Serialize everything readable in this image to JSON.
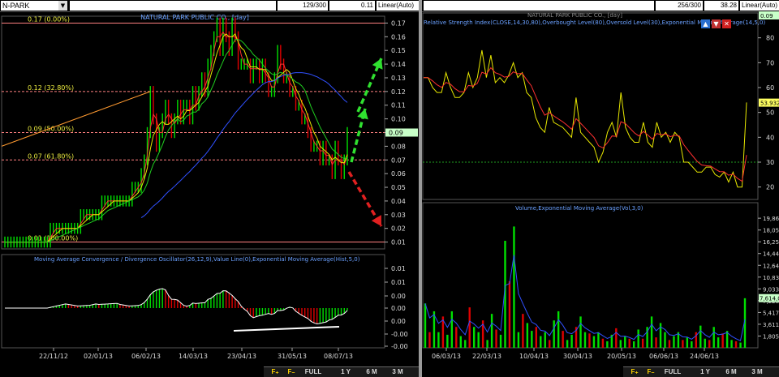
{
  "toolbar_left": {
    "symbol": "N-PARK",
    "bars": "129/300",
    "last": "0.11",
    "scale": "Linear(Auto)"
  },
  "toolbar_right": {
    "bars": "256/300",
    "last": "38.28",
    "scale": "Linear(Auto)",
    "value_box": "0.09"
  },
  "timeframe_buttons": [
    "FULL",
    "1 Y",
    "6 M",
    "3 M"
  ],
  "icons": [
    "zoom-in-icon",
    "zoom-out-icon",
    "dropdown-arrow-icon",
    "arrow-up-icon",
    "arrow-down-icon",
    "close-icon"
  ],
  "colors": {
    "up": "#00e000",
    "down": "#e00000",
    "ma_red": "#ff3030",
    "ma_yellow": "#e8e800",
    "ma_green": "#20d020",
    "ma_blue": "#3050ff",
    "fib": "#ff8080",
    "trend_up": "#30e030",
    "trend_down": "#e02020"
  },
  "chart_data": [
    {
      "type": "bar",
      "title": "NATURAL PARK PUBLIC CO., [day]",
      "y_ticks": [
        "0.17",
        "0.16",
        "0.15",
        "0.14",
        "0.13",
        "0.12",
        "0.11",
        "0.10",
        "0.09",
        "0.08",
        "0.07",
        "0.06",
        "0.05",
        "0.04",
        "0.03",
        "0.02",
        "0.01"
      ],
      "ylim": [
        0.005,
        0.175
      ],
      "x_tick_labels": [
        "22/11/12",
        "02/01/13",
        "06/02/13",
        "14/03/13",
        "23/04/13",
        "31/05/13",
        "08/07/13"
      ],
      "last_price_label": "0.09",
      "fib_levels": [
        {
          "label": "0.17 (0.00%)",
          "value": 0.17
        },
        {
          "label": "0.12 (32.80%)",
          "value": 0.12
        },
        {
          "label": "0.09 (50.00%)",
          "value": 0.09
        },
        {
          "label": "0.07 (61.80%)",
          "value": 0.07
        },
        {
          "label": "0.01 (100.00%)",
          "value": 0.01
        }
      ],
      "closes": [
        0.01,
        0.01,
        0.01,
        0.01,
        0.01,
        0.01,
        0.01,
        0.01,
        0.01,
        0.01,
        0.01,
        0.01,
        0.01,
        0.01,
        0.01,
        0.02,
        0.02,
        0.02,
        0.02,
        0.02,
        0.02,
        0.02,
        0.02,
        0.02,
        0.02,
        0.03,
        0.03,
        0.03,
        0.03,
        0.03,
        0.03,
        0.03,
        0.04,
        0.04,
        0.04,
        0.04,
        0.04,
        0.04,
        0.04,
        0.04,
        0.04,
        0.04,
        0.05,
        0.05,
        0.05,
        0.06,
        0.07,
        0.09,
        0.12,
        0.1,
        0.08,
        0.09,
        0.1,
        0.11,
        0.1,
        0.09,
        0.1,
        0.11,
        0.1,
        0.11,
        0.11,
        0.1,
        0.12,
        0.11,
        0.12,
        0.13,
        0.12,
        0.14,
        0.15,
        0.16,
        0.17,
        0.15,
        0.17,
        0.16,
        0.15,
        0.17,
        0.16,
        0.14,
        0.14,
        0.14,
        0.14,
        0.13,
        0.14,
        0.14,
        0.13,
        0.14,
        0.13,
        0.12,
        0.12,
        0.13,
        0.15,
        0.14,
        0.13,
        0.13,
        0.12,
        0.12,
        0.11,
        0.11,
        0.1,
        0.1,
        0.09,
        0.08,
        0.08,
        0.08,
        0.07,
        0.08,
        0.07,
        0.07,
        0.06,
        0.08,
        0.07,
        0.06,
        0.07,
        0.09
      ],
      "moving_averages": [
        "red",
        "yellow",
        "green",
        "blue"
      ],
      "trend_arrows": [
        "up",
        "up",
        "down"
      ]
    },
    {
      "type": "bar",
      "title": "Moving Average Convergence / Divergence Oscillator(26,12,9),Value Line(0),Exponential Moving Average(Hist,5,0)",
      "y_ticks": [
        "0.01",
        "0.01",
        "0.00",
        "0.00",
        "0.00",
        "-0.00",
        "-0.00"
      ],
      "ylim": [
        -0.0045,
        0.0045
      ]
    },
    {
      "type": "line",
      "title": "Relative Strength Index(CLOSE,14,30,80),Overbought Level(80),Oversold Level(30),Exponential Moving Average(14,5,0)",
      "header_title": "NATURAL PARK PUBLIC CO., [day]",
      "y_ticks": [
        "80",
        "70",
        "60",
        "50",
        "40",
        "30",
        "20"
      ],
      "ylim": [
        15,
        90
      ],
      "last_value_label": "53.9324",
      "overbought": 80,
      "oversold": 30,
      "values": [
        64,
        64,
        60,
        58,
        58,
        66,
        60,
        56,
        56,
        58,
        66,
        60,
        64,
        75,
        64,
        73,
        62,
        64,
        62,
        65,
        70,
        64,
        66,
        58,
        56,
        48,
        44,
        42,
        52,
        46,
        45,
        44,
        42,
        40,
        56,
        42,
        40,
        38,
        36,
        30,
        34,
        42,
        46,
        40,
        58,
        44,
        40,
        38,
        38,
        46,
        38,
        36,
        46,
        40,
        42,
        38,
        42,
        40,
        30,
        30,
        28,
        26,
        26,
        28,
        28,
        25,
        24,
        26,
        22,
        26,
        20,
        20,
        54
      ]
    },
    {
      "type": "bar",
      "title": "Volume,Exponential Moving Average(Vol,3,0)",
      "y_ticks": [
        "19,865",
        "18,052",
        "16,250",
        "14,448",
        "12,643",
        "10,838",
        "9,033",
        "7,228",
        "5,417",
        "3,611",
        "1,805"
      ],
      "last_value_label": "7,614,0",
      "ylim": [
        0,
        21000
      ],
      "x_tick_labels": [
        "06/03/13",
        "22/03/13",
        "10/04/13",
        "30/04/13",
        "20/05/13",
        "06/06/13",
        "24/06/13"
      ],
      "values": [
        6800,
        2400,
        5600,
        2400,
        4800,
        2000,
        5600,
        3200,
        1800,
        1200,
        6200,
        3200,
        2400,
        4200,
        1200,
        5200,
        2800,
        2000,
        16400,
        10200,
        18600,
        2400,
        5200,
        3800,
        2600,
        3200,
        1800,
        2400,
        1200,
        4200,
        5600,
        2600,
        1200,
        2000,
        3200,
        4800,
        2400,
        2200,
        1800,
        2400,
        1400,
        1000,
        2000,
        3000,
        1200,
        1800,
        1400,
        1000,
        2800,
        1400,
        3200,
        4800,
        1600,
        3800,
        2400,
        1200,
        1800,
        2400,
        1200,
        1600,
        1000,
        2400,
        3400,
        1400,
        1200,
        3200,
        1600,
        2200,
        2600,
        1200,
        1000,
        800,
        7600
      ]
    }
  ]
}
